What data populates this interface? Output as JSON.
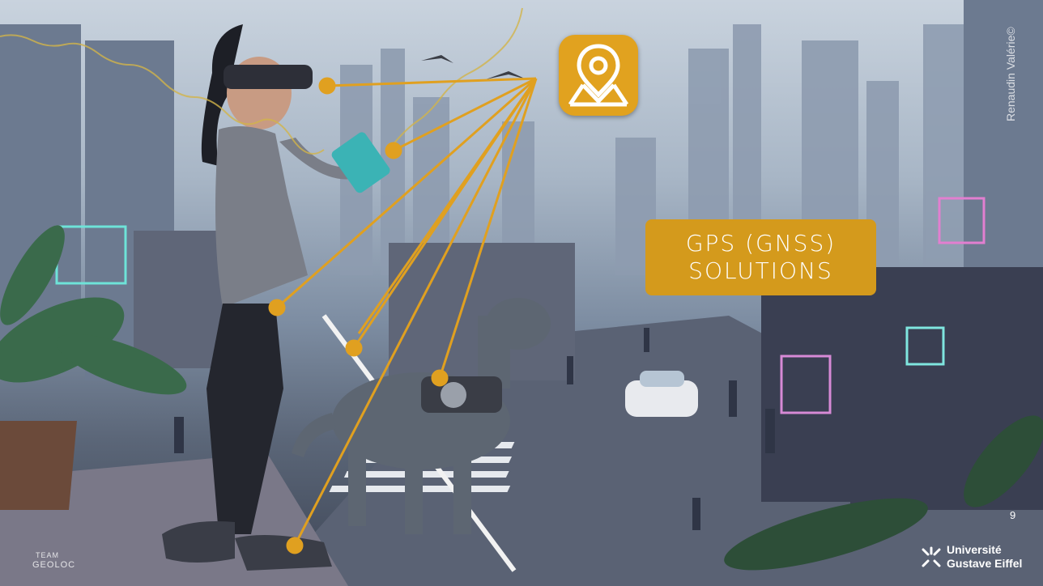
{
  "slide": {
    "label_box": {
      "line1": "GPS (GNSS)",
      "line2": "SOLUTIONS"
    },
    "credit": "Renaudin Valérie©",
    "page_number": "9",
    "team_logo": {
      "line1": "TEAM",
      "line2": "GEOLOC"
    },
    "university_logo": {
      "line1": "Université",
      "line2": "Gustave Eiffel"
    },
    "app_icon": "map-pin-app-icon"
  },
  "colors": {
    "accent": "#d49a1c",
    "connector": "#e0a020"
  }
}
